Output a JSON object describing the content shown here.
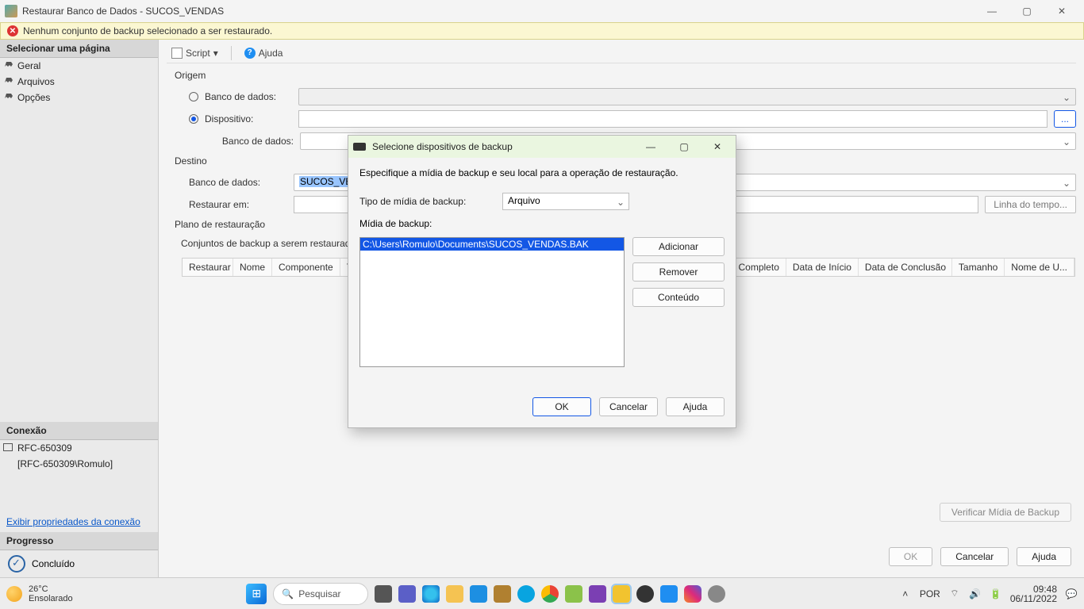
{
  "window": {
    "title": "Restaurar Banco de Dados - SUCOS_VENDAS"
  },
  "warning": {
    "text": "Nenhum conjunto de backup selecionado a ser restaurado."
  },
  "sidebar": {
    "select_page": "Selecionar uma página",
    "items": [
      "Geral",
      "Arquivos",
      "Opções"
    ],
    "connection_header": "Conexão",
    "server": "RFC-650309",
    "user": "[RFC-650309\\Romulo]",
    "view_props_link": "Exibir propriedades da conexão",
    "progress_header": "Progresso",
    "progress_text": "Concluído"
  },
  "toolbar": {
    "script": "Script",
    "help": "Ajuda"
  },
  "origin": {
    "label": "Origem",
    "radio_db": "Banco de dados:",
    "radio_device": "Dispositivo:",
    "db_label2": "Banco de dados:",
    "browse": "..."
  },
  "dest": {
    "label": "Destino",
    "db_label": "Banco de dados:",
    "db_value": "SUCOS_VEN",
    "restore_to": "Restaurar em:",
    "timeline_btn": "Linha do tempo..."
  },
  "plan": {
    "label": "Plano de restauração",
    "sets_label": "Conjuntos de backup a serem restaurados:"
  },
  "grid": {
    "cols": [
      "Restaurar",
      "Nome",
      "Componente",
      "Tipo",
      "LSN Completo",
      "Data de Início",
      "Data de Conclusão",
      "Tamanho",
      "Nome de U..."
    ]
  },
  "verify_btn": "Verificar Mídia de Backup",
  "footer": {
    "ok": "OK",
    "cancel": "Cancelar",
    "help": "Ajuda"
  },
  "dialog": {
    "title": "Selecione dispositivos de backup",
    "instruction": "Especifique a mídia de backup e seu local para a operação de restauração.",
    "media_type_label": "Tipo de mídia de backup:",
    "media_type_value": "Arquivo",
    "media_label": "Mídia de backup:",
    "selected_path": "C:\\Users\\Romulo\\Documents\\SUCOS_VENDAS.BAK",
    "add": "Adicionar",
    "remove": "Remover",
    "contents": "Conteúdo",
    "ok": "OK",
    "cancel": "Cancelar",
    "help": "Ajuda"
  },
  "taskbar": {
    "temp": "26°C",
    "weather": "Ensolarado",
    "search": "Pesquisar",
    "lang": "POR",
    "time": "09:48",
    "date": "06/11/2022"
  }
}
